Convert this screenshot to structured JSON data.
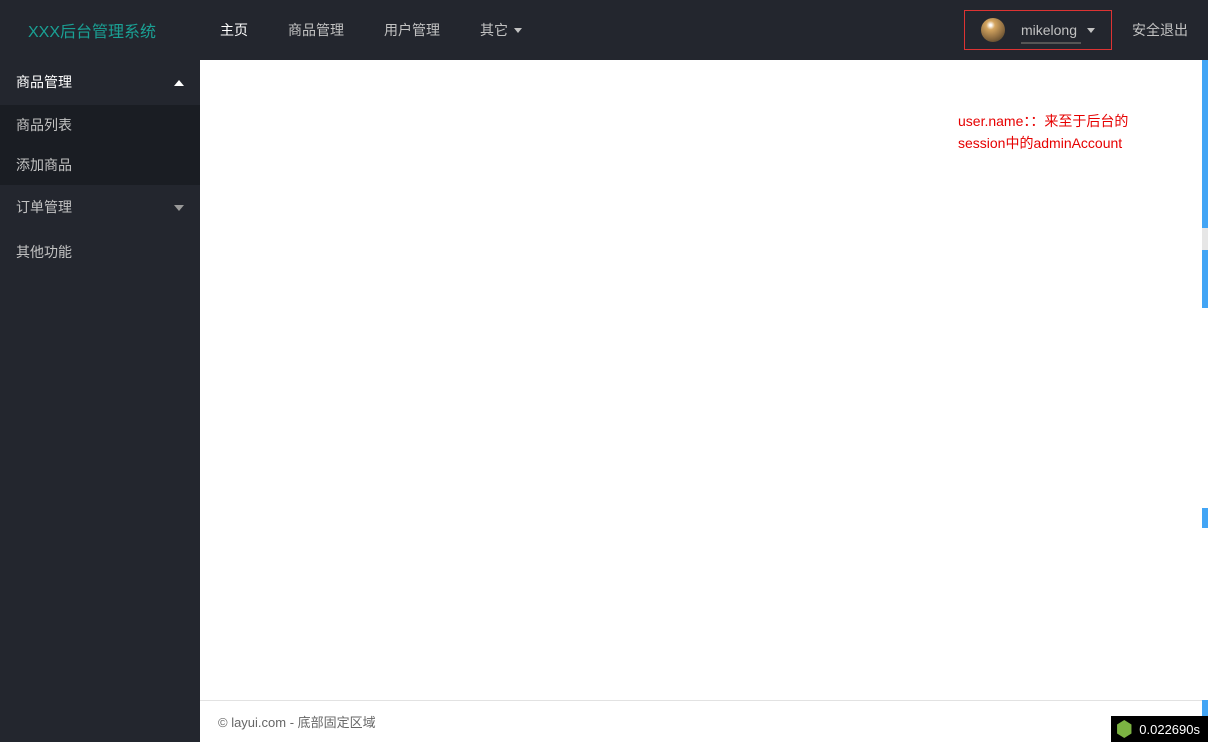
{
  "header": {
    "logo": "XXX后台管理系统",
    "nav": [
      {
        "label": "主页",
        "hasCaret": false
      },
      {
        "label": "商品管理",
        "hasCaret": false
      },
      {
        "label": "用户管理",
        "hasCaret": false
      },
      {
        "label": "其它",
        "hasCaret": true
      }
    ],
    "user": {
      "name": "mikelong"
    },
    "logout": "安全退出"
  },
  "sidebar": {
    "groups": [
      {
        "title": "商品管理",
        "expanded": true,
        "items": [
          "商品列表",
          "添加商品"
        ]
      },
      {
        "title": "订单管理",
        "expanded": false,
        "items": []
      },
      {
        "title": "其他功能",
        "expanded": null,
        "items": []
      }
    ]
  },
  "main": {
    "annotation": "user.name：：来至于后台的session中的adminAccount"
  },
  "footer": {
    "text": "© layui.com - 底部固定区域"
  },
  "perf": {
    "value": "0.022690s"
  },
  "colors": {
    "headerBg": "#23262E",
    "accent": "#1AA094",
    "annotationRed": "#e60000",
    "highlightBorder": "#d33"
  }
}
